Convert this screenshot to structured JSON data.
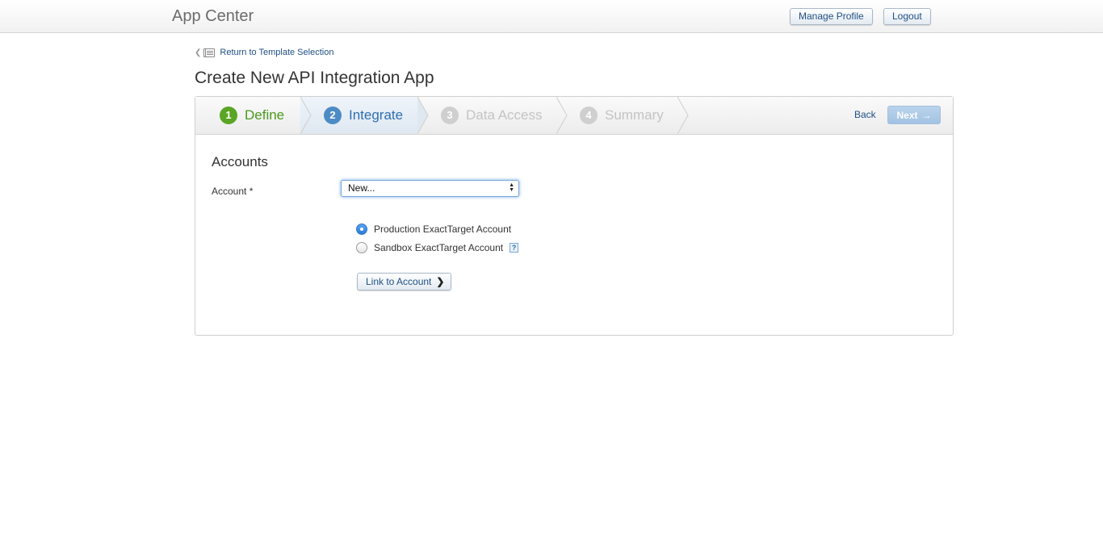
{
  "header": {
    "app_title": "App Center",
    "manage_profile_label": "Manage Profile",
    "logout_label": "Logout"
  },
  "breadcrumb": {
    "back_link_label": "Return to Template Selection",
    "chevron_icon": "chevron-left-icon",
    "list_icon": "list-icon"
  },
  "page": {
    "title": "Create New API Integration App"
  },
  "wizard": {
    "steps": [
      {
        "number": "1",
        "label": "Define",
        "state": "complete"
      },
      {
        "number": "2",
        "label": "Integrate",
        "state": "current"
      },
      {
        "number": "3",
        "label": "Data Access",
        "state": "upcoming"
      },
      {
        "number": "4",
        "label": "Summary",
        "state": "upcoming"
      }
    ],
    "back_label": "Back",
    "next_label": "Next",
    "next_arrow": "→",
    "colors": {
      "complete": "#5aa524",
      "current": "#4d8bc4",
      "upcoming": "#cfcfcf"
    }
  },
  "accounts": {
    "section_title": "Accounts",
    "account_label": "Account *",
    "account_selected": "New...",
    "radio_options": [
      {
        "label": "Production ExactTarget Account",
        "checked": true
      },
      {
        "label": "Sandbox ExactTarget Account",
        "checked": false
      }
    ],
    "help_icon_glyph": "?",
    "link_button_label": "Link to Account",
    "link_button_chevron": "❯"
  }
}
